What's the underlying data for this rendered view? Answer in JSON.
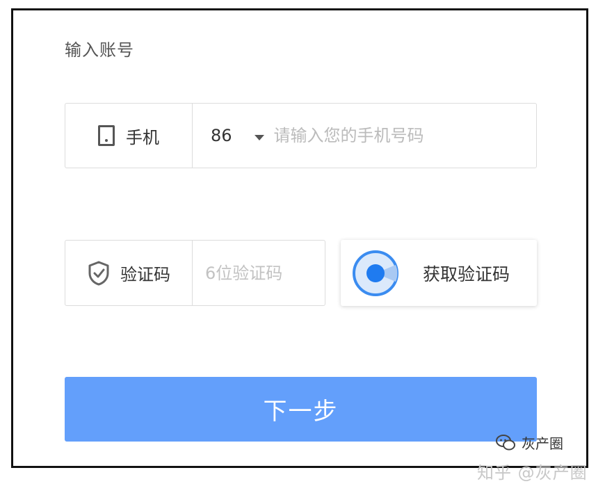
{
  "form": {
    "section_title": "输入账号",
    "phone": {
      "label": "手机",
      "icon": "phone-icon",
      "country_code": "86",
      "placeholder": "请输入您的手机号码",
      "value": ""
    },
    "code": {
      "label": "验证码",
      "icon": "shield-check-icon",
      "placeholder": "6位验证码",
      "value": ""
    },
    "get_code_button": {
      "label": "获取验证码",
      "icon": "captcha-radar-icon"
    },
    "next_button": {
      "label": "下一步"
    }
  },
  "colors": {
    "primary": "#639ffb",
    "border": "#dcdcdc",
    "placeholder": "#bbbbbb",
    "captcha_ring": "#3b8cf0",
    "captcha_fill": "#dbe9fb"
  },
  "watermark": {
    "inner_text": "灰产圈",
    "inner_icon": "wechat-icon",
    "outer_text": "知乎 @灰产圈"
  }
}
